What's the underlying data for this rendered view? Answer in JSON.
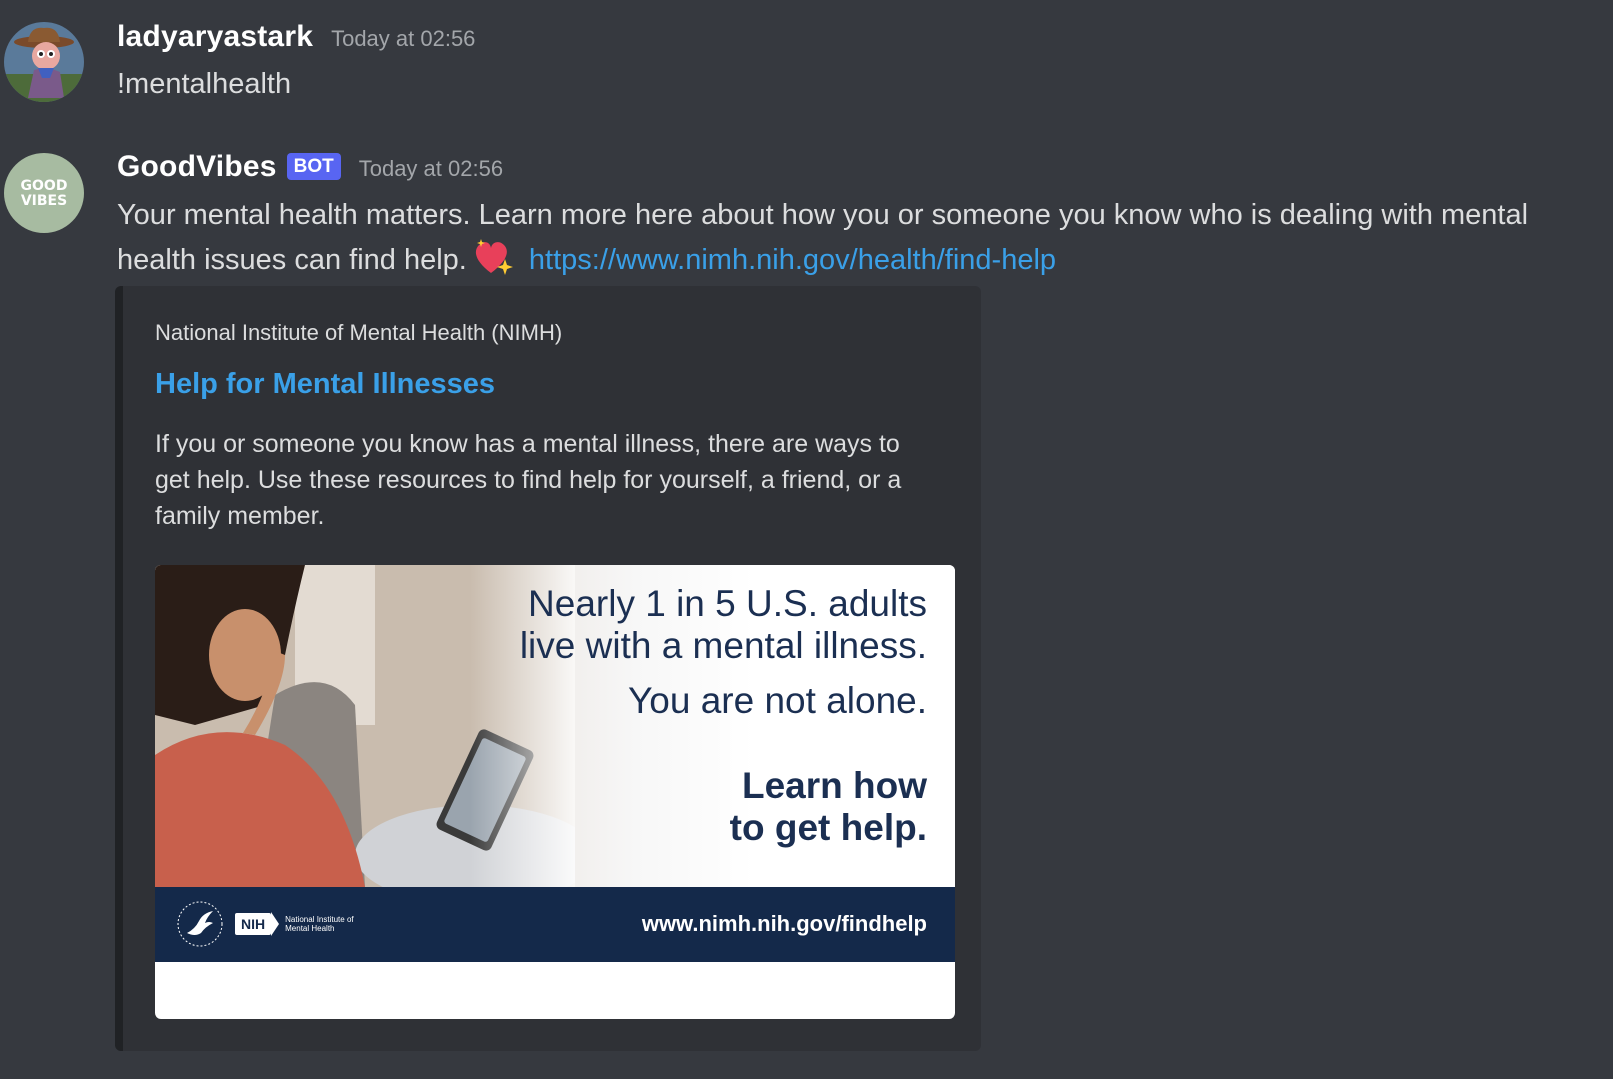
{
  "messages": [
    {
      "username": "ladyaryastark",
      "timestamp": "Today at 02:56",
      "text": "!mentalhealth"
    },
    {
      "username": "GoodVibes",
      "bot_tag": "BOT",
      "timestamp": "Today at 02:56",
      "text_line1": "Your mental health matters. Learn more here about how you or someone you know who is dealing with mental",
      "text_line2": "health issues can find help.",
      "emoji": "sparkling-heart-icon",
      "link": "https://www.nimh.nih.gov/health/find-help",
      "avatar_text": "GOOD VIBES"
    }
  ],
  "embed": {
    "provider": "National Institute of Mental Health (NIMH)",
    "title": "Help for Mental Illnesses",
    "description_lines": [
      "If you or someone you know has a mental illness, there are ways to",
      "get help. Use these resources to find help for yourself, a friend, or a",
      "family member."
    ],
    "image": {
      "line1": "Nearly 1 in 5 U.S. adults",
      "line2": "live with a mental illness.",
      "line3": "You are not alone.",
      "line4": "Learn how",
      "line5": "to get help.",
      "footer_url": "www.nimh.nih.gov/findhelp",
      "nih_label": "NIH",
      "nih_name": "National Institute of Mental Health"
    }
  },
  "colors": {
    "background": "#36393f",
    "embed_bg": "#2f3136",
    "link": "#3aa0e8",
    "bot_tag": "#5865f2",
    "banner_navy": "#14294a"
  }
}
